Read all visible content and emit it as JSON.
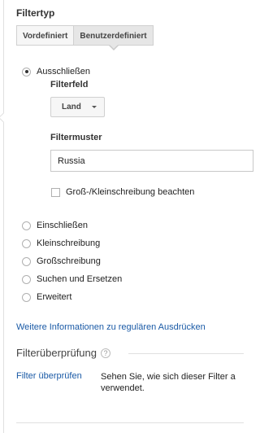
{
  "filter_type": {
    "title": "Filtertyp",
    "tabs": [
      "Vordefiniert",
      "Benutzerdefiniert"
    ],
    "active_tab": "Benutzerdefiniert"
  },
  "options": {
    "exclude": "Ausschließen",
    "include": "Einschließen",
    "lowercase": "Kleinschreibung",
    "uppercase": "Großschreibung",
    "search_replace": "Suchen und Ersetzen",
    "advanced": "Erweitert",
    "selected": "Ausschließen"
  },
  "filter_field": {
    "label": "Filterfeld",
    "value": "Land"
  },
  "filter_pattern": {
    "label": "Filtermuster",
    "value": "Russia"
  },
  "case_sensitive": {
    "label": "Groß-/Kleinschreibung beachten",
    "checked": false
  },
  "regex_link": "Weitere Informationen zu regulären Ausdrücken",
  "verification": {
    "heading": "Filterüberprüfung",
    "help": "?",
    "link": "Filter überprüfen",
    "description": "Sehen Sie, wie sich dieser Filter a verwendet."
  }
}
